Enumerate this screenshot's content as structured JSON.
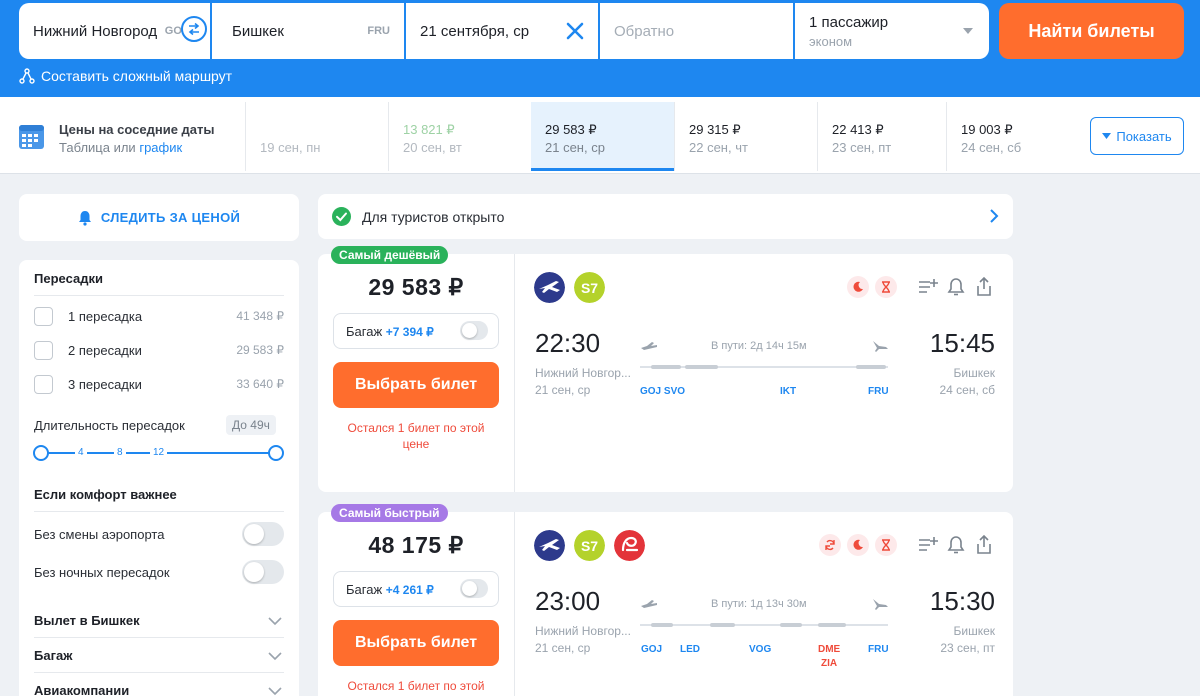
{
  "search": {
    "origin": "Нижний Новгород",
    "origin_code": "GOJ",
    "destination": "Бишкек",
    "destination_code": "FRU",
    "date": "21 сентября, ср",
    "return_placeholder": "Обратно",
    "passengers": "1 пассажир",
    "cabin": "эконом",
    "find_button": "Найти билеты",
    "complex_route": "Составить сложный маршрут"
  },
  "nearby_dates": {
    "title": "Цены на соседние даты",
    "subtitle_prefix": "Таблица или",
    "subtitle_link": "график",
    "cells": [
      {
        "price": "",
        "date": "19 сен, пн"
      },
      {
        "price": "13 821 ₽",
        "date": "20 сен, вт"
      },
      {
        "price": "29 583 ₽",
        "date": "21 сен, ср"
      },
      {
        "price": "29 315 ₽",
        "date": "22 сен, чт"
      },
      {
        "price": "22 413 ₽",
        "date": "23 сен, пт"
      },
      {
        "price": "19 003 ₽",
        "date": "24 сен, сб"
      }
    ],
    "show_button": "Показать"
  },
  "sidebar": {
    "watch_price": "СЛЕДИТЬ ЗА ЦЕНОЙ",
    "transfers_title": "Пересадки",
    "transfers": [
      {
        "label": "1 пересадка",
        "price": "41 348 ₽"
      },
      {
        "label": "2 пересадки",
        "price": "29 583 ₽"
      },
      {
        "label": "3 пересадки",
        "price": "33 640 ₽"
      }
    ],
    "duration_label": "Длительность пересадок",
    "duration_badge": "До 49ч",
    "duration_ticks": [
      "4",
      "8",
      "12"
    ],
    "comfort_title": "Если комфорт важнее",
    "comfort": [
      {
        "label": "Без смены аэропорта"
      },
      {
        "label": "Без ночных пересадок"
      }
    ],
    "accordions": [
      "Вылет в Бишкек",
      "Багаж",
      "Авиакомпании"
    ]
  },
  "tourist_banner": "Для туристов открыто",
  "tickets": [
    {
      "badge": "Самый дешёвый",
      "price": "29 583 ₽",
      "baggage_label": "Багаж",
      "baggage_price": "+7 394 ₽",
      "buy": "Выбрать билет",
      "note": "Остался 1 билет по этой цене",
      "dep_time": "22:30",
      "dep_city": "Нижний Новгор...",
      "dep_date": "21 сен, ср",
      "arr_time": "15:45",
      "arr_city": "Бишкек",
      "arr_date": "24 сен, сб",
      "duration": "В пути: 2д 14ч 15м",
      "airports": [
        "GOJ SVO",
        "IKT",
        "FRU"
      ]
    },
    {
      "badge": "Самый быстрый",
      "price": "48 175 ₽",
      "baggage_label": "Багаж",
      "baggage_price": "+4 261 ₽",
      "buy": "Выбрать билет",
      "note": "Остался 1 билет по этой",
      "dep_time": "23:00",
      "dep_city": "Нижний Новгор...",
      "dep_date": "21 сен, ср",
      "arr_time": "15:30",
      "arr_city": "Бишкек",
      "arr_date": "23 сен, пт",
      "duration": "В пути: 1д 13ч 30м",
      "airports": [
        "GOJ",
        "LED",
        "VOG",
        "DME",
        "ZIA",
        "FRU"
      ]
    }
  ],
  "colors": {
    "brand_blue": "#1e87f0",
    "orange": "#ff6d2d",
    "green_badge": "#2ab25b",
    "purple_badge": "#a679e6",
    "alert_red": "#ef4b3b"
  }
}
